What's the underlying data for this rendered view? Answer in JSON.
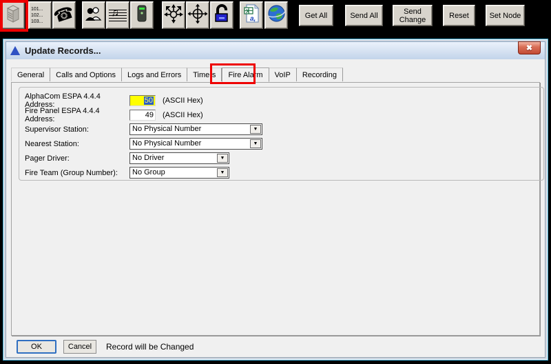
{
  "toolbar": {
    "station_list_lines": [
      "101...",
      "102...",
      "103..."
    ],
    "buttons": [
      "Get All",
      "Send All",
      "Send Change",
      "Reset",
      "Set Node"
    ],
    "icons": [
      "node-server-icon",
      "station-list-icon",
      "handset-icon",
      "users-icon",
      "music-notes-icon",
      "intercom-station-icon",
      "distribute-arrows-icon",
      "crosshair-arrows-icon",
      "open-lock-icon",
      "excel-export-icon",
      "globe-icon"
    ]
  },
  "dialog": {
    "title": "Update Records...",
    "tabs": [
      {
        "label": "General"
      },
      {
        "label": "Calls and Options"
      },
      {
        "label": "Logs and Errors"
      },
      {
        "label": "Timers"
      },
      {
        "label": "Fire Alarm"
      },
      {
        "label": "VoIP"
      },
      {
        "label": "Recording"
      }
    ],
    "active_tab": "Fire Alarm",
    "fields": [
      {
        "label": "AlphaCom ESPA 4.4.4 Address:",
        "value": "50",
        "suffix": "(ASCII Hex)"
      },
      {
        "label": "Fire Panel ESPA 4.4.4 Address:",
        "value": "49",
        "suffix": "(ASCII Hex)"
      },
      {
        "label": "Supervisor Station:",
        "value": "No Physical Number"
      },
      {
        "label": "Nearest Station:",
        "value": "No Physical Number"
      },
      {
        "label": "Pager Driver:",
        "value": "No Driver"
      },
      {
        "label": "Fire Team (Group Number):",
        "value": "No Group"
      }
    ],
    "footer": {
      "ok": "OK",
      "cancel": "Cancel",
      "status": "Record will be Changed"
    }
  },
  "colors": {
    "annotation_red": "#ee0000",
    "field_highlight_yellow": "#ffff00",
    "selection_blue": "#2b5cc8",
    "title_gradient_top": "#ebf2fc",
    "title_gradient_bottom": "#c2d4ea",
    "toolbar_button_gray": "#d8d4cc"
  }
}
